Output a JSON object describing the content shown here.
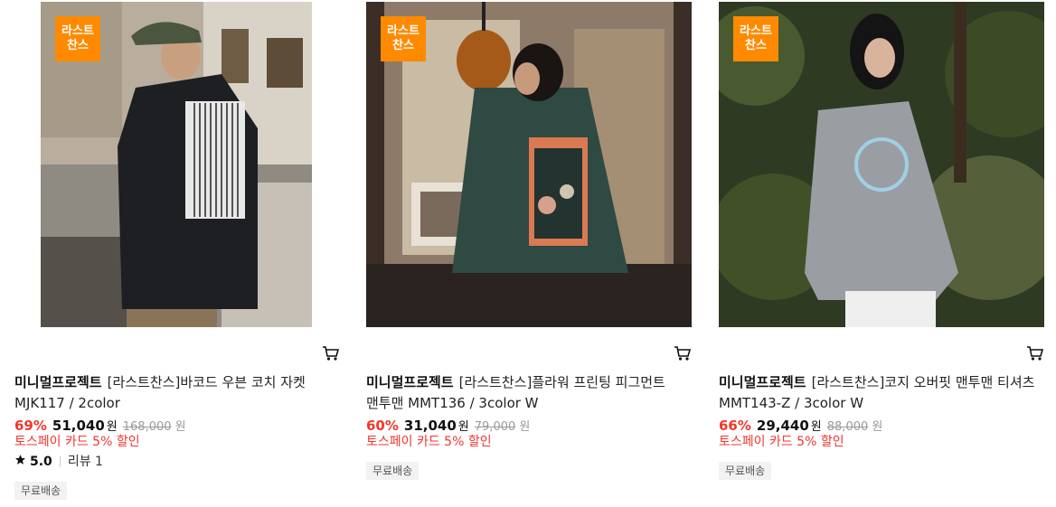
{
  "products": [
    {
      "badge_line1": "라스트",
      "badge_line2": "찬스",
      "brand": "미니멀프로젝트",
      "name": "[라스트찬스]바코드 우븐 코치 자켓 MJK117 / 2color",
      "discount": "69%",
      "sale_price": "51,040",
      "won": "원",
      "original_price": "168,000",
      "original_won": "원",
      "promo": "토스페이 카드 5% 할인",
      "rating": "5.0",
      "review": "리뷰 1",
      "tag": "무료배송"
    },
    {
      "badge_line1": "라스트",
      "badge_line2": "찬스",
      "brand": "미니멀프로젝트",
      "name": "[라스트찬스]플라워 프린팅 피그먼트 맨투맨 MMT136 / 3color W",
      "discount": "60%",
      "sale_price": "31,040",
      "won": "원",
      "original_price": "79,000",
      "original_won": "원",
      "promo": "토스페이 카드 5% 할인",
      "tag": "무료배송"
    },
    {
      "badge_line1": "라스트",
      "badge_line2": "찬스",
      "brand": "미니멀프로젝트",
      "name": "[라스트찬스]코지 오버핏 맨투맨 티셔츠 MMT143-Z / 3color W",
      "discount": "66%",
      "sale_price": "29,440",
      "won": "원",
      "original_price": "88,000",
      "original_won": "원",
      "promo": "토스페이 카드 5% 할인",
      "tag": "무료배송"
    }
  ],
  "icons": {
    "cart": "cart-icon",
    "star": "star-icon"
  },
  "colors": {
    "badge": "#ff8a00",
    "discount": "#f1362c",
    "promo": "#f1362c"
  }
}
